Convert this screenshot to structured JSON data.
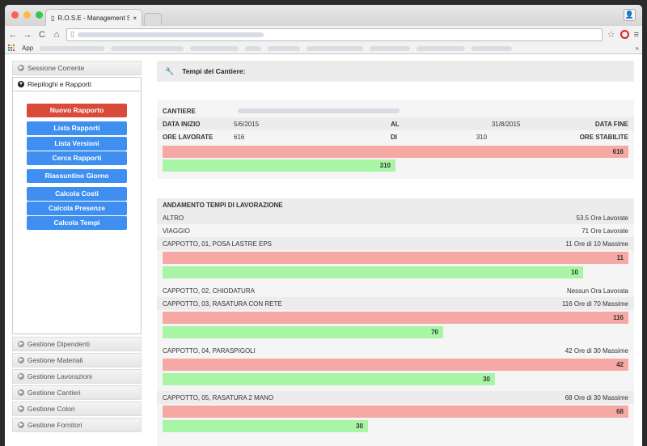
{
  "browser": {
    "tab_title": "R.O.S.E - Management Syst",
    "apps_label": "App",
    "bookmarks_more": "»"
  },
  "sidebar": {
    "items_top": [
      {
        "label": "Sessione Corrente",
        "icon": "chevron-right-icon"
      },
      {
        "label": "Riepiloghi e Rapporti",
        "icon": "chevron-down-icon"
      }
    ],
    "buttons": [
      {
        "label": "Nuovo Rapporto",
        "color": "#d94a3a"
      },
      {
        "label": "Lista Rapporti",
        "color": "#3f8ff0"
      },
      {
        "label": "Lista Versioni",
        "color": "#3f8ff0"
      },
      {
        "label": "Cerca Rapporti",
        "color": "#3f8ff0"
      },
      {
        "label": "Riassuntino Giorno",
        "color": "#3f8ff0"
      },
      {
        "label": "Calcola Costi",
        "color": "#3f8ff0"
      },
      {
        "label": "Calcola Presenze",
        "color": "#3f8ff0"
      },
      {
        "label": "Calcola Tempi",
        "color": "#3f8ff0"
      }
    ],
    "items_bottom": [
      {
        "label": "Gestione Dipendenti"
      },
      {
        "label": "Gestione Materiali"
      },
      {
        "label": "Gestione Lavorazioni"
      },
      {
        "label": "Gestione Cantieri"
      },
      {
        "label": "Gestione Colori"
      },
      {
        "label": "Gestione Fornitori"
      }
    ]
  },
  "main": {
    "header": "Tempi del Cantiere:",
    "cantiere": {
      "label": "CANTIERE",
      "data_inizio_label": "DATA INIZIO",
      "data_inizio": "5/6/2015",
      "al_label": "AL",
      "al": "31/8/2015",
      "data_fine_label": "DATA FINE",
      "ore_lavorate_label": "ORE LAVORATE",
      "ore_lavorate": "616",
      "di_label": "DI",
      "di": "310",
      "ore_stabilite_label": "ORE STABILITE",
      "bar_red": 616,
      "bar_green": 310
    },
    "andamento": {
      "title": "ANDAMENTO TEMPI DI LAVORAZIONE",
      "rows": [
        {
          "name": "ALTRO",
          "summary": "53.5 Ore Lavorate"
        },
        {
          "name": "VIAGGIO",
          "summary": "71 Ore Lavorate"
        },
        {
          "name": "CAPPOTTO, 01, POSA LASTRE EPS",
          "summary": "11 Ore di 10 Massime",
          "red": 11,
          "green": 10,
          "green_frac": 0.902
        },
        {
          "name": "CAPPOTTO, 02, CHIODATURA",
          "summary": "Nessun Ora Lavorata"
        },
        {
          "name": "CAPPOTTO, 03, RASATURA CON RETE",
          "summary": "116 Ore di 70 Massime",
          "red": 116,
          "green": 70,
          "green_frac": 0.603
        },
        {
          "name": "CAPPOTTO, 04, PARASPIGOLI",
          "summary": "42 Ore di 30 Massime",
          "red": 42,
          "green": 30,
          "green_frac": 0.714
        },
        {
          "name": "CAPPOTTO, 05, RASATURA 2 MANO",
          "summary": "68 Ore di 30 Massime",
          "red": 68,
          "green": 30,
          "green_frac": 0.441
        }
      ]
    }
  }
}
